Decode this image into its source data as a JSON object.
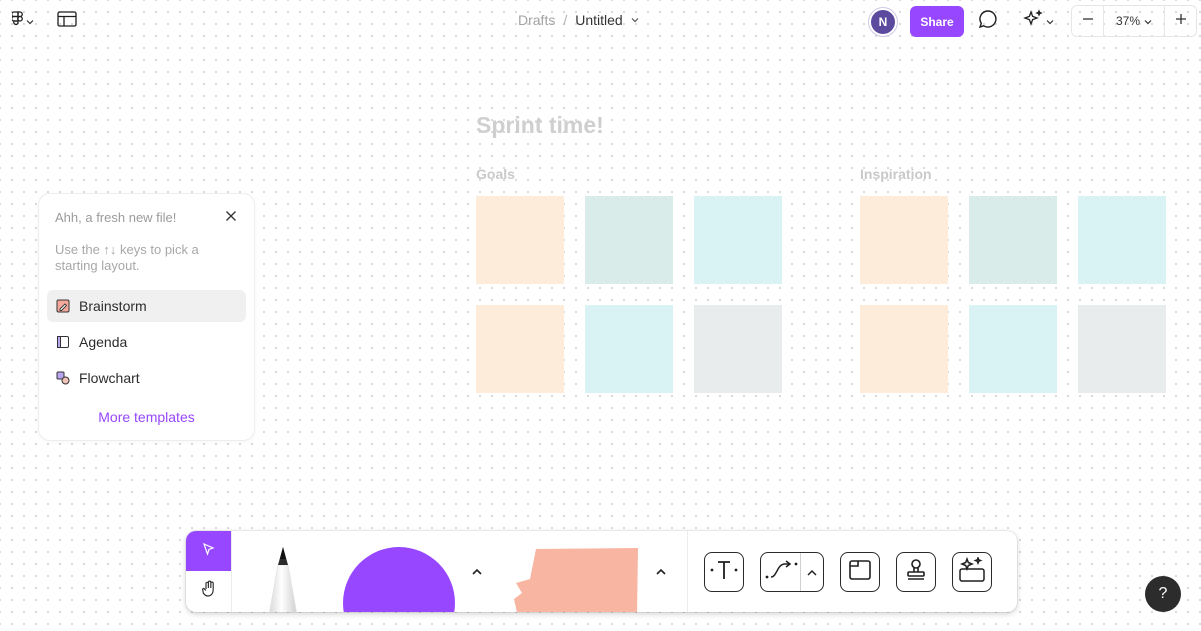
{
  "topbar": {
    "breadcrumb_parent": "Drafts",
    "breadcrumb_separator": "/",
    "file_title": "Untitled",
    "avatar_initial": "N",
    "share_label": "Share",
    "zoom_level": "37%",
    "zoom_out_symbol": "−",
    "zoom_in_symbol": "+"
  },
  "canvas": {
    "heading": "Sprint time!",
    "sections": [
      {
        "label": "Goals"
      },
      {
        "label": "Inspiration"
      }
    ],
    "note_colors": {
      "peach": "#fdecd9",
      "teal_textured": "#d9ecea",
      "cyan": "#d9f3f5",
      "gray": "#e9eced"
    }
  },
  "template_panel": {
    "title": "Ahh, a fresh new file!",
    "hint": "Use the ↑↓ keys to pick a starting layout.",
    "items": [
      {
        "label": "Brainstorm",
        "icon": "brainstorm-icon",
        "active": true
      },
      {
        "label": "Agenda",
        "icon": "agenda-icon",
        "active": false
      },
      {
        "label": "Flowchart",
        "icon": "flowchart-icon",
        "active": false
      }
    ],
    "more_label": "More templates"
  },
  "toolbar": {
    "tools": [
      "select-tool",
      "hand-tool",
      "pencil-tool",
      "shape-tool",
      "sticky-note-tool",
      "text-tool",
      "connector-tool",
      "section-tool",
      "stamp-tool",
      "ai-tool"
    ],
    "accent": "#9747ff",
    "sticky_color": "#f8b5a1"
  },
  "help": {
    "label": "?"
  }
}
